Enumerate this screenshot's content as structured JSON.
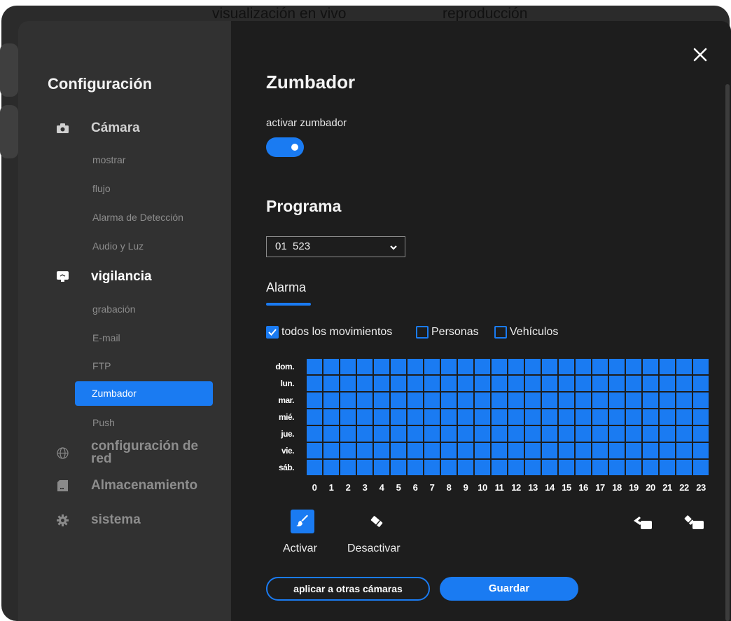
{
  "top_tabs": [
    "visualización en vivo",
    "reproducción"
  ],
  "sidebar": {
    "title": "Configuración",
    "camera": {
      "label": "Cámara",
      "items": [
        "mostrar",
        "flujo",
        "Alarma de Detección",
        "Audio y Luz"
      ]
    },
    "surveillance": {
      "label": "vigilancia",
      "items": [
        "grabación",
        "E-mail",
        "FTP",
        "Zumbador",
        "Push"
      ],
      "active": "Zumbador"
    },
    "network": {
      "label_line1": "configuración de",
      "label_line2": "red"
    },
    "storage": {
      "label": "Almacenamiento"
    },
    "system": {
      "label": "sistema"
    }
  },
  "main": {
    "title": "Zumbador",
    "enable_label": "activar zumbador",
    "enable_on": true,
    "schedule_title": "Programa",
    "schedule_select": "01  523",
    "tab": "Alarma",
    "checkboxes": [
      {
        "label": "todos los movimientos",
        "checked": true
      },
      {
        "label": "Personas",
        "checked": false
      },
      {
        "label": "Vehículos",
        "checked": false
      }
    ],
    "schedule": {
      "days": [
        "dom.",
        "lun.",
        "mar.",
        "mié.",
        "jue.",
        "vie.",
        "sáb."
      ],
      "hours": [
        "0",
        "1",
        "2",
        "3",
        "4",
        "5",
        "6",
        "7",
        "8",
        "9",
        "10",
        "11",
        "12",
        "13",
        "14",
        "15",
        "16",
        "17",
        "18",
        "19",
        "20",
        "21",
        "22",
        "23"
      ],
      "all_active": true
    },
    "tools": {
      "activate": "Activar",
      "deactivate": "Desactivar"
    },
    "apply_button": "aplicar a otras cámaras",
    "save_button": "Guardar"
  },
  "colors": {
    "accent": "#1a7bf2",
    "sidebar_bg": "#313131",
    "main_bg": "#1d1d1d"
  }
}
